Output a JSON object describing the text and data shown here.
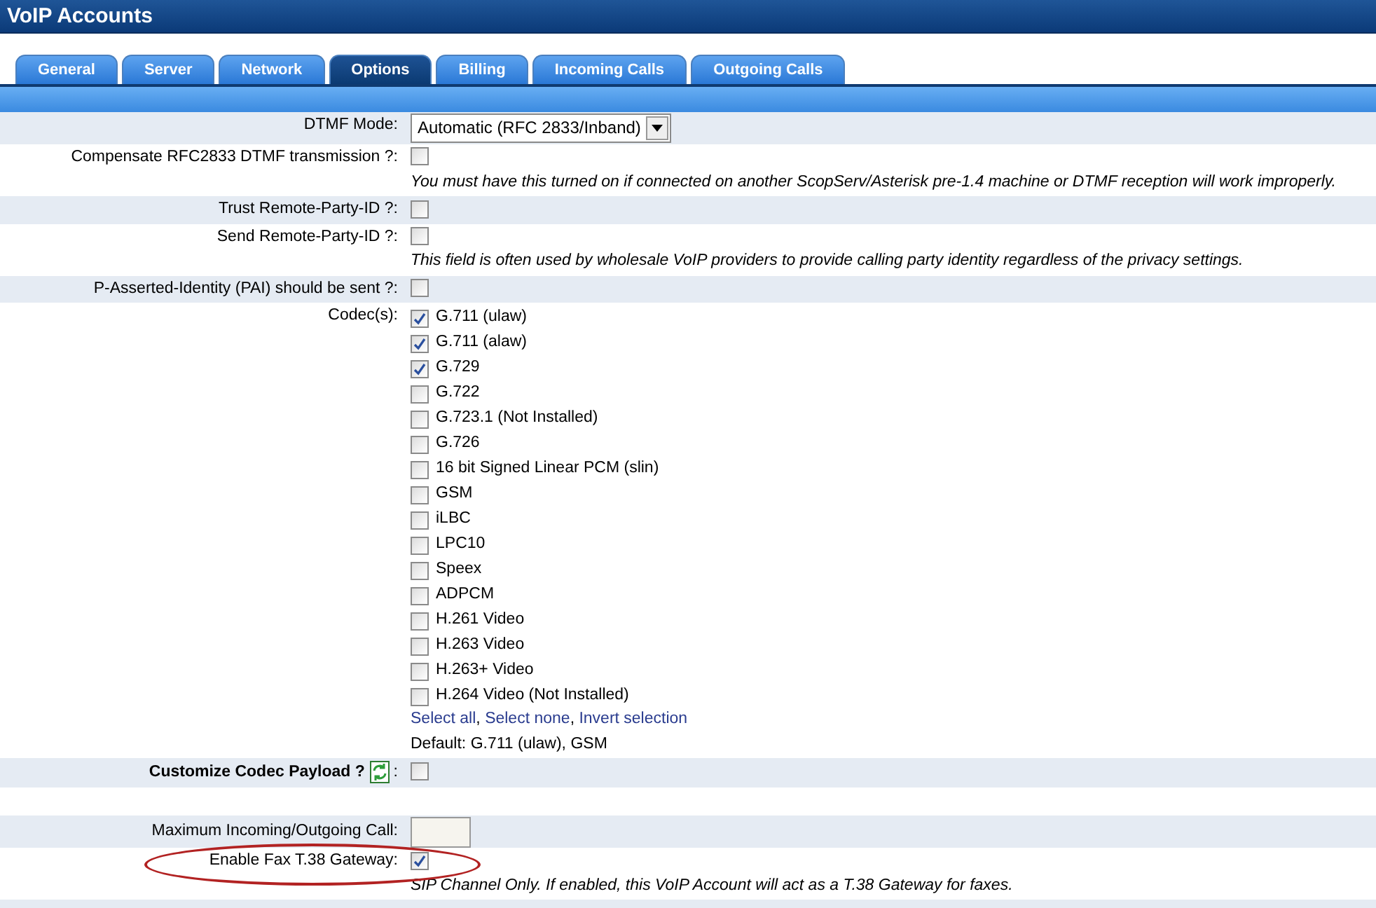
{
  "window": {
    "title": "VoIP Accounts"
  },
  "tabs": [
    {
      "label": "General",
      "selected": false
    },
    {
      "label": "Server",
      "selected": false
    },
    {
      "label": "Network",
      "selected": false
    },
    {
      "label": "Options",
      "selected": true
    },
    {
      "label": "Billing",
      "selected": false
    },
    {
      "label": "Incoming Calls",
      "selected": false
    },
    {
      "label": "Outgoing Calls",
      "selected": false
    }
  ],
  "rows": [
    {
      "kind": "select",
      "label": "DTMF Mode:",
      "value": "Automatic (RFC 2833/Inband)"
    },
    {
      "kind": "checkbox",
      "label": "Compensate RFC2833 DTMF transmission ?:",
      "checked": false,
      "note": "You must have this turned on if connected on another ScopServ/Asterisk pre-1.4 machine or DTMF reception will work improperly."
    },
    {
      "kind": "checkbox",
      "label": "Trust Remote-Party-ID ?:",
      "checked": false
    },
    {
      "kind": "checkbox",
      "label": "Send Remote-Party-ID ?:",
      "checked": false,
      "note": "This field is often used by wholesale VoIP providers to provide calling party identity regardless of the privacy settings."
    },
    {
      "kind": "checkbox",
      "label": "P-Asserted-Identity (PAI) should be sent ?:",
      "checked": false
    },
    {
      "kind": "codecs",
      "label": "Codec(s):",
      "codecs": [
        {
          "label": "G.711 (ulaw)",
          "checked": true
        },
        {
          "label": "G.711 (alaw)",
          "checked": true
        },
        {
          "label": "G.729",
          "checked": true
        },
        {
          "label": "G.722",
          "checked": false
        },
        {
          "label": "G.723.1 (Not Installed)",
          "checked": false
        },
        {
          "label": "G.726",
          "checked": false
        },
        {
          "label": "16 bit Signed Linear PCM (slin)",
          "checked": false
        },
        {
          "label": "GSM",
          "checked": false
        },
        {
          "label": "iLBC",
          "checked": false
        },
        {
          "label": "LPC10",
          "checked": false
        },
        {
          "label": "Speex",
          "checked": false
        },
        {
          "label": "ADPCM",
          "checked": false
        },
        {
          "label": "H.261 Video",
          "checked": false
        },
        {
          "label": "H.263 Video",
          "checked": false
        },
        {
          "label": "H.263+ Video",
          "checked": false
        },
        {
          "label": "H.264 Video (Not Installed)",
          "checked": false
        }
      ],
      "links": [
        "Select all",
        "Select none",
        "Invert selection"
      ],
      "separator": ", ",
      "default": "Default: G.711 (ulaw), GSM"
    },
    {
      "kind": "checkbox-icon",
      "label": "Customize Codec Payload ?",
      "colon": ":",
      "checked": false
    },
    {
      "kind": "blank"
    },
    {
      "kind": "text",
      "label": "Maximum Incoming/Outgoing Call:",
      "value": ""
    },
    {
      "kind": "checkbox",
      "label": "Enable Fax T.38 Gateway:",
      "checked": true,
      "highlighted": true,
      "note": "SIP Channel Only. If enabled, this VoIP Account will act as a T.38 Gateway for faxes."
    },
    {
      "kind": "blank"
    }
  ]
}
